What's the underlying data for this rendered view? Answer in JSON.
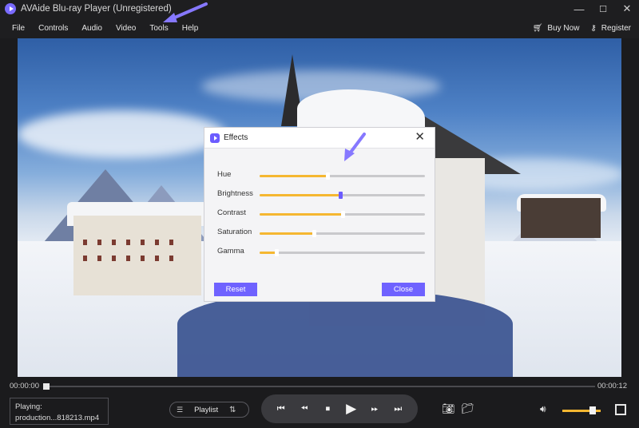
{
  "window": {
    "title": "AVAide Blu-ray Player (Unregistered)",
    "controls": [
      "—",
      "☐",
      "✕"
    ]
  },
  "menu": {
    "items": [
      "File",
      "Controls",
      "Audio",
      "Video",
      "Tools",
      "Help"
    ],
    "buy_now": "Buy Now",
    "register": "Register"
  },
  "effects_dialog": {
    "title": "Effects",
    "sliders": [
      {
        "label": "Hue",
        "value": 0.41
      },
      {
        "label": "Brightness",
        "value": 0.49,
        "active": true
      },
      {
        "label": "Contrast",
        "value": 0.5
      },
      {
        "label": "Saturation",
        "value": 0.33
      },
      {
        "label": "Gamma",
        "value": 0.1
      }
    ],
    "reset_label": "Reset",
    "close_label": "Close"
  },
  "playback": {
    "current_time": "00:00:00",
    "total_time": "00:00:12",
    "progress": 0.0,
    "now_playing_label": "Playing:",
    "now_playing_file": "production...818213.mp4",
    "playlist_label": "Playlist",
    "volume": 0.8
  },
  "colors": {
    "accent": "#6f62ff",
    "slider_fill": "#f5b731",
    "background": "#1b1b1d"
  }
}
